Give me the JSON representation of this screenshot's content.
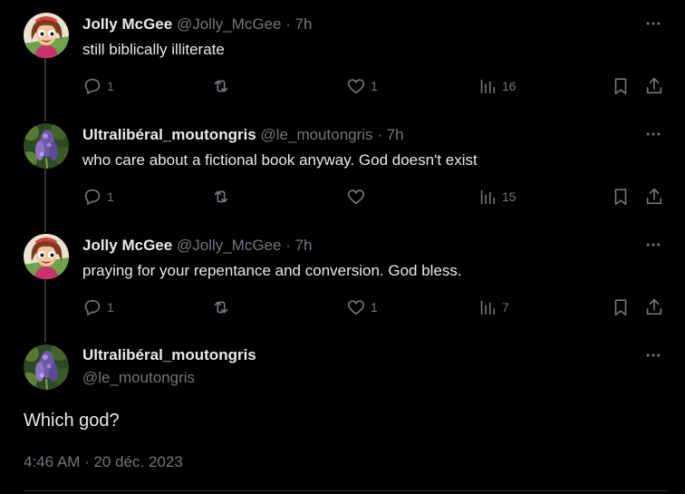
{
  "colors": {
    "background": "#000000",
    "text": "#e7e9ea",
    "muted": "#71767b",
    "divider": "#2f3336"
  },
  "replies": [
    {
      "name": "Jolly McGee",
      "handle": "@Jolly_McGee",
      "time": "· 7h",
      "text": "still biblically illiterate",
      "avatar": "cartoon-avatar",
      "reply_count": "1",
      "retweet_count": "",
      "like_count": "1",
      "view_count": "16"
    },
    {
      "name": "Ultralibéral_moutongris",
      "handle": "@le_moutongris",
      "time": "· 7h",
      "text": "who care about a fictional book anyway. God doesn't exist",
      "avatar": "flower-avatar",
      "reply_count": "1",
      "retweet_count": "",
      "like_count": "",
      "view_count": "15"
    },
    {
      "name": "Jolly McGee",
      "handle": "@Jolly_McGee",
      "time": "· 7h",
      "text": "praying for your repentance and conversion. God bless.",
      "avatar": "cartoon-avatar",
      "reply_count": "1",
      "retweet_count": "",
      "like_count": "1",
      "view_count": "7"
    }
  ],
  "focused": {
    "name": "Ultralibéral_moutongris",
    "handle": "@le_moutongris",
    "text": "Which god?",
    "timestamp": "4:46 AM · 20 déc. 2023",
    "avatar": "flower-avatar"
  },
  "icons": [
    "reply-icon",
    "retweet-icon",
    "like-icon",
    "views-icon",
    "bookmark-icon",
    "share-icon",
    "more-icon"
  ]
}
